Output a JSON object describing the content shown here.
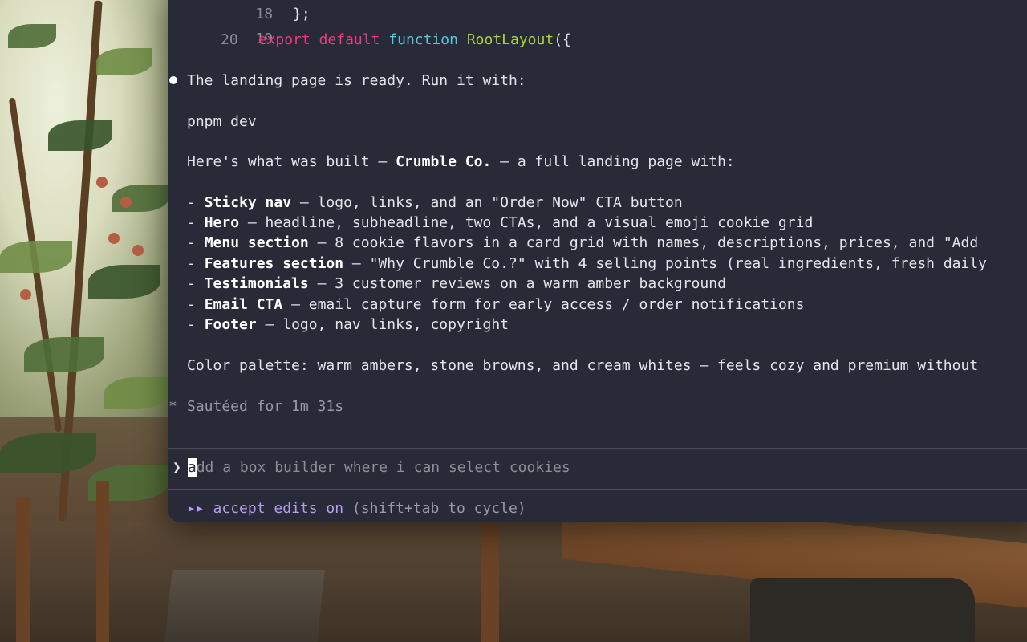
{
  "code": [
    {
      "n": "18",
      "text": "};"
    },
    {
      "n": "19",
      "text": ""
    },
    {
      "n": "20",
      "kw1": "export",
      "kw2": "default",
      "kw3": "function",
      "fn": "RootLayout",
      "tail": "({"
    }
  ],
  "message": {
    "intro": "The landing page is ready. Run it with:",
    "command": "pnpm dev",
    "built_prefix": "Here's what was built — ",
    "built_name": "Crumble Co.",
    "built_suffix": " — a full landing page with:",
    "items": [
      {
        "dash": "- ",
        "title": "Sticky nav",
        "desc": " — logo, links, and an \"Order Now\" CTA button"
      },
      {
        "dash": "- ",
        "title": "Hero",
        "desc": " — headline, subheadline, two CTAs, and a visual emoji cookie grid"
      },
      {
        "dash": "- ",
        "title": "Menu section",
        "desc": " — 8 cookie flavors in a card grid with names, descriptions, prices, and \"Add"
      },
      {
        "dash": "- ",
        "title": "Features section",
        "desc": " — \"Why Crumble Co.?\" with 4 selling points (real ingredients, fresh daily"
      },
      {
        "dash": "- ",
        "title": "Testimonials",
        "desc": " — 3 customer reviews on a warm amber background"
      },
      {
        "dash": "- ",
        "title": "Email CTA",
        "desc": " — email capture form for early access / order notifications"
      },
      {
        "dash": "- ",
        "title": "Footer",
        "desc": " — logo, nav links, copyright"
      }
    ],
    "palette": "Color palette: warm ambers, stone browns, and cream whites — feels cozy and premium without"
  },
  "status": {
    "glyph": "*",
    "text": "Sautéed for 1m 31s"
  },
  "input": {
    "prompt": "❯",
    "cursor_char": "a",
    "rest": "dd a box builder where i can select cookies"
  },
  "mode": {
    "arrows": "▸▸",
    "label": "accept edits on",
    "hint": " (shift+tab to cycle)"
  }
}
